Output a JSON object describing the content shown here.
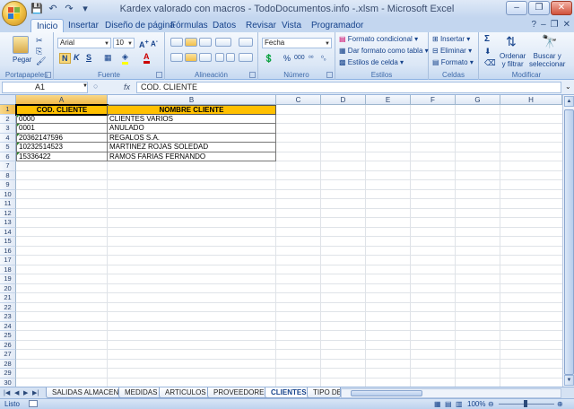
{
  "window": {
    "title": "Kardex valorado con macros - TodoDocumentos.info -.xlsm - Microsoft Excel",
    "minimize": "–",
    "restore": "❐",
    "close": "✕"
  },
  "qat": {
    "save": "💾",
    "undo": "↶",
    "redo": "↷",
    "customize": "▾"
  },
  "ribbon_tabs": [
    {
      "label": "Inicio",
      "active": true
    },
    {
      "label": "Insertar"
    },
    {
      "label": "Diseño de página"
    },
    {
      "label": "Fórmulas"
    },
    {
      "label": "Datos"
    },
    {
      "label": "Revisar"
    },
    {
      "label": "Vista"
    },
    {
      "label": "Programador"
    }
  ],
  "ribbon": {
    "clipboard": {
      "label": "Portapapeles",
      "paste": "Pegar"
    },
    "font": {
      "label": "Fuente",
      "name": "Arial",
      "size": "10",
      "bold": "N",
      "italic": "K",
      "underline": "S"
    },
    "alignment": {
      "label": "Alineación"
    },
    "number": {
      "label": "Número",
      "format": "Fecha",
      "percent": "%",
      "thousands": "000"
    },
    "styles": {
      "label": "Estilos",
      "conditional": "Formato condicional",
      "as_table": "Dar formato como tabla",
      "cell_styles": "Estilos de celda"
    },
    "cells": {
      "label": "Celdas",
      "insert": "Insertar",
      "delete": "Eliminar",
      "format": "Formato"
    },
    "editing": {
      "label": "Modificar",
      "sum": "Σ",
      "sort": "Ordenar\ny filtrar",
      "find": "Buscar y\nseleccionar"
    }
  },
  "formula_bar": {
    "name_box": "A1",
    "fx": "fx",
    "content": "COD. CLIENTE"
  },
  "columns": [
    "A",
    "B",
    "C",
    "D",
    "E",
    "F",
    "G",
    "H"
  ],
  "rows": [
    "1",
    "2",
    "3",
    "4",
    "5",
    "6",
    "7",
    "8",
    "9",
    "10",
    "11",
    "12",
    "13",
    "14",
    "15",
    "16",
    "17",
    "18",
    "19",
    "20",
    "21",
    "22",
    "23",
    "24",
    "25",
    "26",
    "27",
    "28",
    "29",
    "30"
  ],
  "table": {
    "headers": [
      "COD. CLIENTE",
      "NOMBRE CLIENTE"
    ],
    "records": [
      [
        "0000",
        "CLIENTES VARIOS"
      ],
      [
        "0001",
        "ANULADO"
      ],
      [
        "20362147596",
        "REGALOS S.A."
      ],
      [
        "10232514523",
        "MARTINEZ ROJAS SOLEDAD"
      ],
      [
        "15336422",
        "RAMOS FARIAS FERNANDO"
      ]
    ]
  },
  "sheet_tabs": [
    {
      "label": "SALIDAS ALMACEN"
    },
    {
      "label": "MEDIDAS"
    },
    {
      "label": "ARTICULOS"
    },
    {
      "label": "PROVEEDORES"
    },
    {
      "label": "CLIENTES",
      "active": true
    },
    {
      "label": "TIPO DE"
    }
  ],
  "status": {
    "text": "Listo",
    "zoom": "100%"
  },
  "colors": {
    "header_fill": "#ffc000",
    "accent": "#15428b"
  }
}
